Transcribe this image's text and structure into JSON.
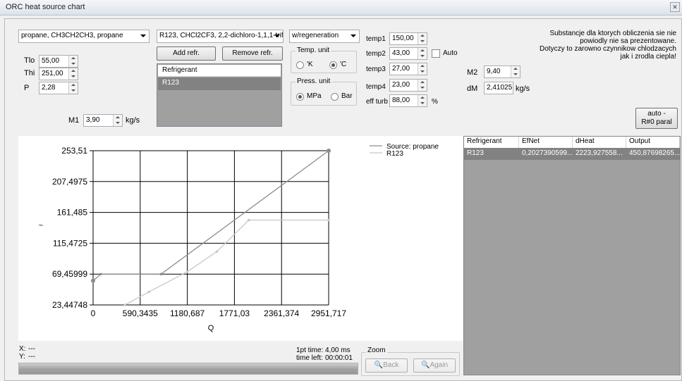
{
  "window": {
    "title": "ORC heat source chart"
  },
  "source_combo": {
    "value": "propane, CH3CH2CH3, propane"
  },
  "refrigerant_combo": {
    "value": "R123, CHCl2CF3, 2,2-dichloro-1,1,1-trif"
  },
  "mode_combo": {
    "value": "w/regeneration"
  },
  "inputs": {
    "tlo": {
      "label": "Tlo",
      "value": "55,00"
    },
    "thi": {
      "label": "Thi",
      "value": "251,00"
    },
    "p": {
      "label": "P",
      "value": "2,28"
    },
    "m1": {
      "label": "M1",
      "value": "3,90",
      "unit": "kg/s"
    },
    "temp1": {
      "label": "temp1",
      "value": "150,00"
    },
    "temp2": {
      "label": "temp2",
      "value": "43,00"
    },
    "temp3": {
      "label": "temp3",
      "value": "27,00"
    },
    "temp4": {
      "label": "temp4",
      "value": "23,00"
    },
    "eff_turb": {
      "label": "eff turb",
      "value": "88,00",
      "unit": "%"
    },
    "m2": {
      "label": "M2",
      "value": "9,40"
    },
    "dm": {
      "label": "dM",
      "value": "2,41025",
      "unit": "kg/s"
    }
  },
  "auto_checkbox": {
    "label": "Auto",
    "checked": false
  },
  "buttons": {
    "add_refr": "Add refr.",
    "remove_refr": "Remove refr.",
    "auto_paral_1": "auto -",
    "auto_paral_2": "R#0 paral"
  },
  "refrigerant_list": {
    "header": "Refrigerant",
    "items": [
      "R123"
    ]
  },
  "temp_unit": {
    "title": "Temp. unit",
    "options": [
      "'K",
      "'C"
    ],
    "selected": "'C"
  },
  "press_unit": {
    "title": "Press. unit",
    "options": [
      "MPa",
      "Bar"
    ],
    "selected": "MPa"
  },
  "note": {
    "line1": "Substancje dla ktorych obliczenia sie nie",
    "line2": "powiodly nie sa prezentowane.",
    "line3": "Dotyczy to zarowno czynnikow chlodzacych",
    "line4": "jak i zrodla ciepla!"
  },
  "results_table": {
    "columns": [
      "Refrigerant",
      "EfNet",
      "dHeat",
      "Output"
    ],
    "rows": [
      [
        "R123",
        "0,2027390599...",
        "2223,927558...",
        "450,87698265..."
      ]
    ]
  },
  "status": {
    "x_label": "X:",
    "x_value": "---",
    "y_label": "Y:",
    "y_value": "---",
    "pt_time_label": "1pt time:",
    "pt_time_value": "4,00 ms",
    "time_left_label": "time left:",
    "time_left_value": "00:00:01",
    "progress": 1.0
  },
  "zoom": {
    "title": "Zoom",
    "back": "Back",
    "again": "Again"
  },
  "colors": {
    "source_series": "#8c8c8c",
    "r123_series": "#c8c8c8",
    "selection": "#828282"
  },
  "chart_data": {
    "type": "line",
    "xlabel": "Q",
    "ylabel": "~",
    "xlim": [
      0,
      2951.717
    ],
    "ylim": [
      23.44748,
      253.51
    ],
    "x_ticks": [
      "0",
      "590,3435",
      "1180,687",
      "1771,03",
      "2361,374",
      "2951,717"
    ],
    "y_ticks": [
      "253,51",
      "207,4975",
      "161,485",
      "115,4725",
      "69,45999",
      "23,44748"
    ],
    "grid": true,
    "legend_position": "top-right",
    "series": [
      {
        "name": "Source: propane",
        "points": [
          [
            0,
            59.5
          ],
          [
            95,
            69.4
          ],
          [
            850,
            69.4
          ],
          [
            2951.717,
            253.51
          ]
        ]
      },
      {
        "name": "R123",
        "points": [
          [
            400,
            23.45
          ],
          [
            700,
            43
          ],
          [
            1180.687,
            73
          ],
          [
            1550,
            103
          ],
          [
            1950,
            150
          ],
          [
            2951.717,
            150
          ]
        ]
      }
    ]
  }
}
